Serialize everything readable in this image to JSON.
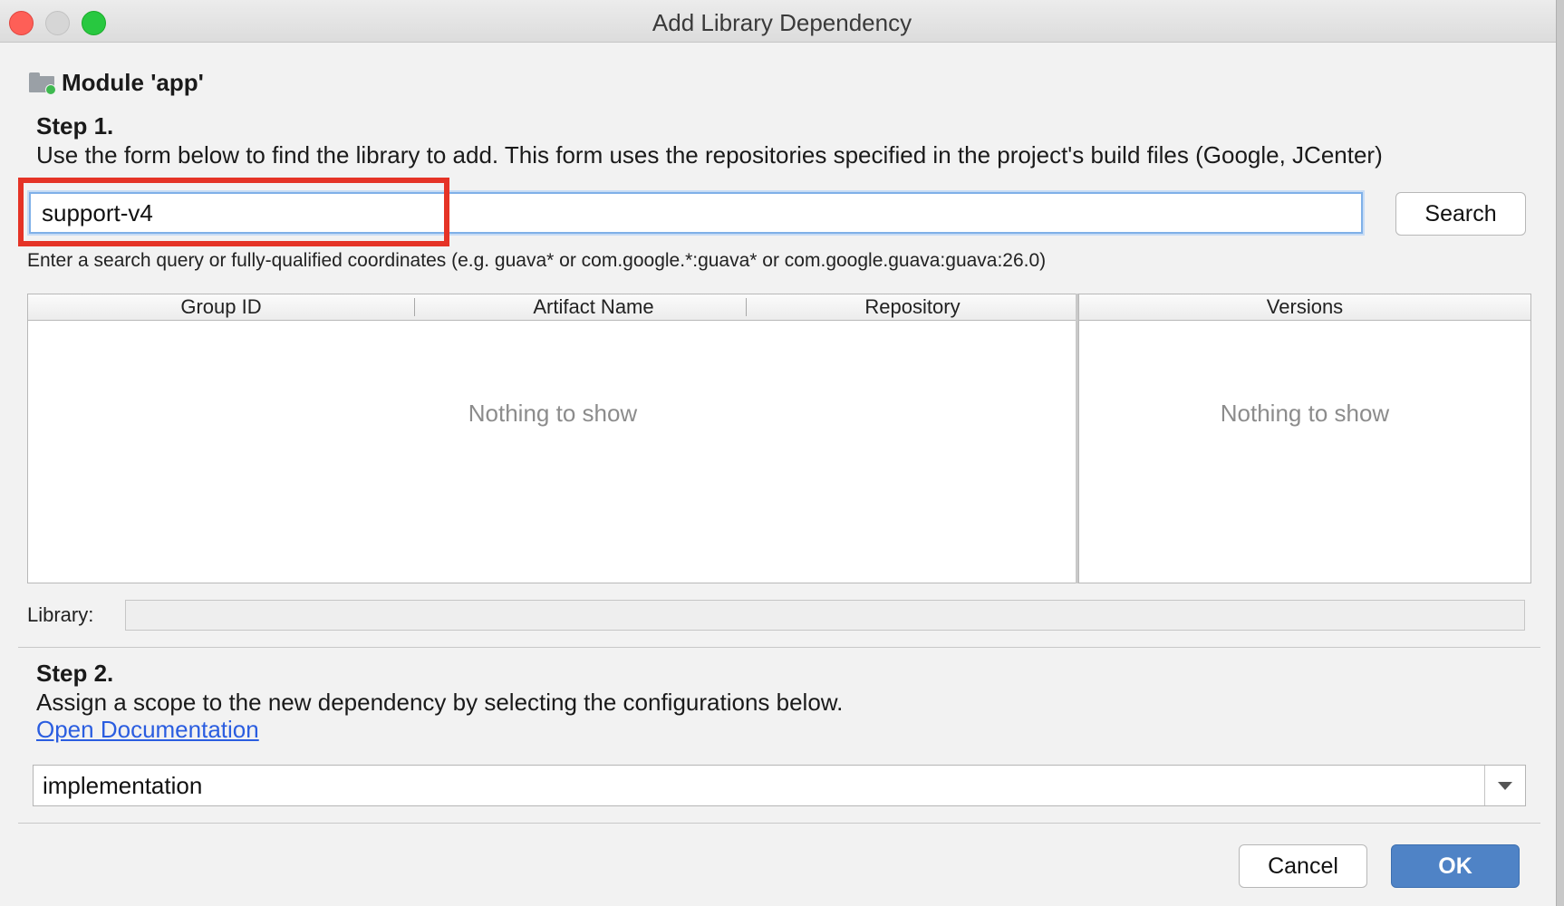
{
  "window": {
    "title": "Add Library Dependency"
  },
  "module": {
    "name": "Module 'app'"
  },
  "step1": {
    "title": "Step 1.",
    "description": "Use the form below to find the library to add. This form uses the repositories specified in the project's build files (Google, JCenter)",
    "search_value": "support-v4",
    "search_button": "Search",
    "hint": "Enter a search query or fully-qualified coordinates (e.g. guava* or com.google.*:guava* or com.google.guava:guava:26.0)"
  },
  "table": {
    "columns": [
      "Group ID",
      "Artifact Name",
      "Repository"
    ],
    "empty_text": "Nothing to show"
  },
  "versions": {
    "header": "Versions",
    "empty_text": "Nothing to show"
  },
  "library": {
    "label": "Library:",
    "value": ""
  },
  "step2": {
    "title": "Step 2.",
    "description": "Assign a scope to the new dependency by selecting the configurations below.",
    "link": "Open Documentation",
    "configuration": "implementation"
  },
  "footer": {
    "cancel": "Cancel",
    "ok": "OK"
  },
  "colors": {
    "highlight": "#e53326",
    "ok_button": "#4f83c6",
    "link": "#2a5de0"
  }
}
